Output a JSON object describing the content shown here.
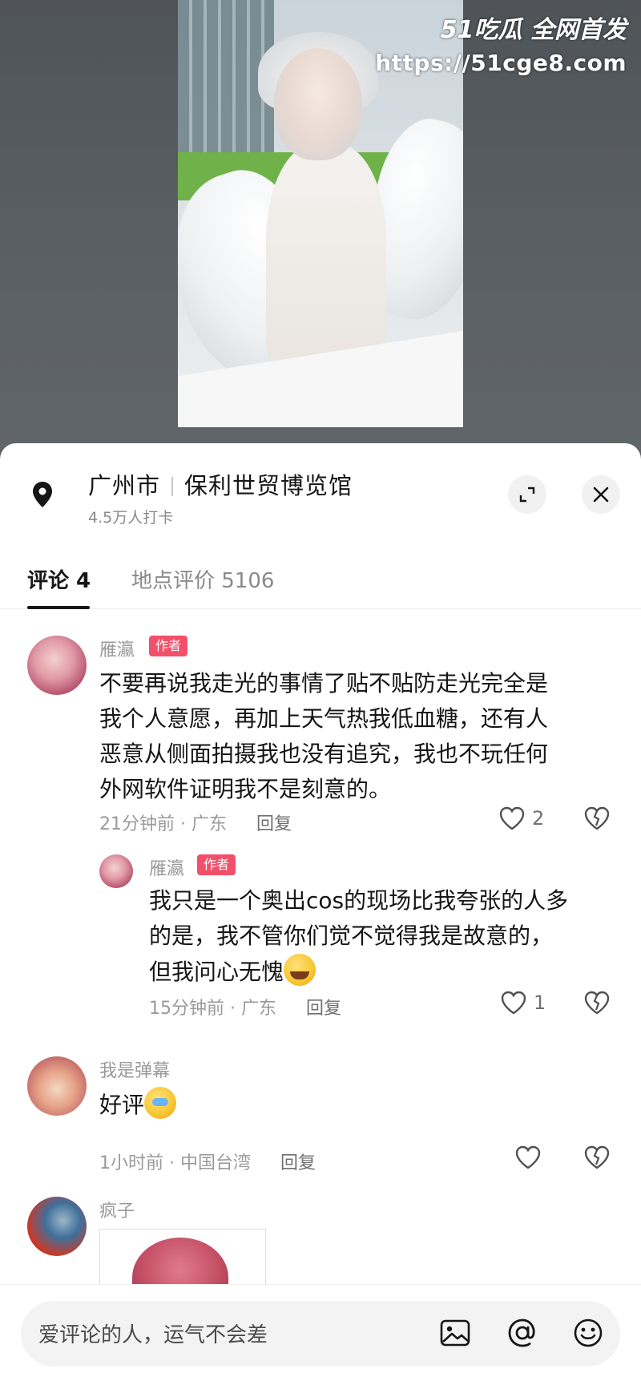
{
  "watermark": {
    "line1": "51吃瓜 全网首发",
    "line2": "https://51cge8.com"
  },
  "location": {
    "city": "广州市",
    "venue": "保利世贸博览馆",
    "checkins": "4.5万人打卡"
  },
  "tabs": {
    "comments": "评论 4",
    "reviews": "地点评价 5106"
  },
  "comments": [
    {
      "user": "雁瀛",
      "badge": "作者",
      "text_lines": [
        "不要再说我走光的事情了贴不贴防走光完全是",
        "我个人意愿，再加上天气热我低血糖，还有人",
        "恶意从侧面拍摄我也没有追究，我也不玩任何",
        "外网软件证明我不是刻意的。"
      ],
      "time": "21分钟前 · 广东",
      "reply": "回复",
      "likes": "2"
    },
    {
      "user": "雁瀛",
      "badge": "作者",
      "text_lines": [
        "我只是一个奥出cos的现场比我夸张的人多",
        "的是，我不管你们觉不觉得我是故意的，",
        "但我问心无愧"
      ],
      "time": "15分钟前 · 广东",
      "reply": "回复",
      "likes": "1"
    },
    {
      "user": "我是弹幕",
      "text": "好评",
      "time": "1小时前 · 中国台湾",
      "reply": "回复"
    },
    {
      "user": "疯子"
    }
  ],
  "input": {
    "placeholder": "爱评论的人，运气不会差"
  },
  "colors": {
    "accent_badge": "#f2506a",
    "text_primary": "#161616",
    "text_secondary": "#9a9a9a"
  },
  "icons": [
    "location-pin-icon",
    "expand-icon",
    "close-icon",
    "heart-icon",
    "broken-heart-icon",
    "image-icon",
    "at-icon",
    "smile-icon"
  ]
}
